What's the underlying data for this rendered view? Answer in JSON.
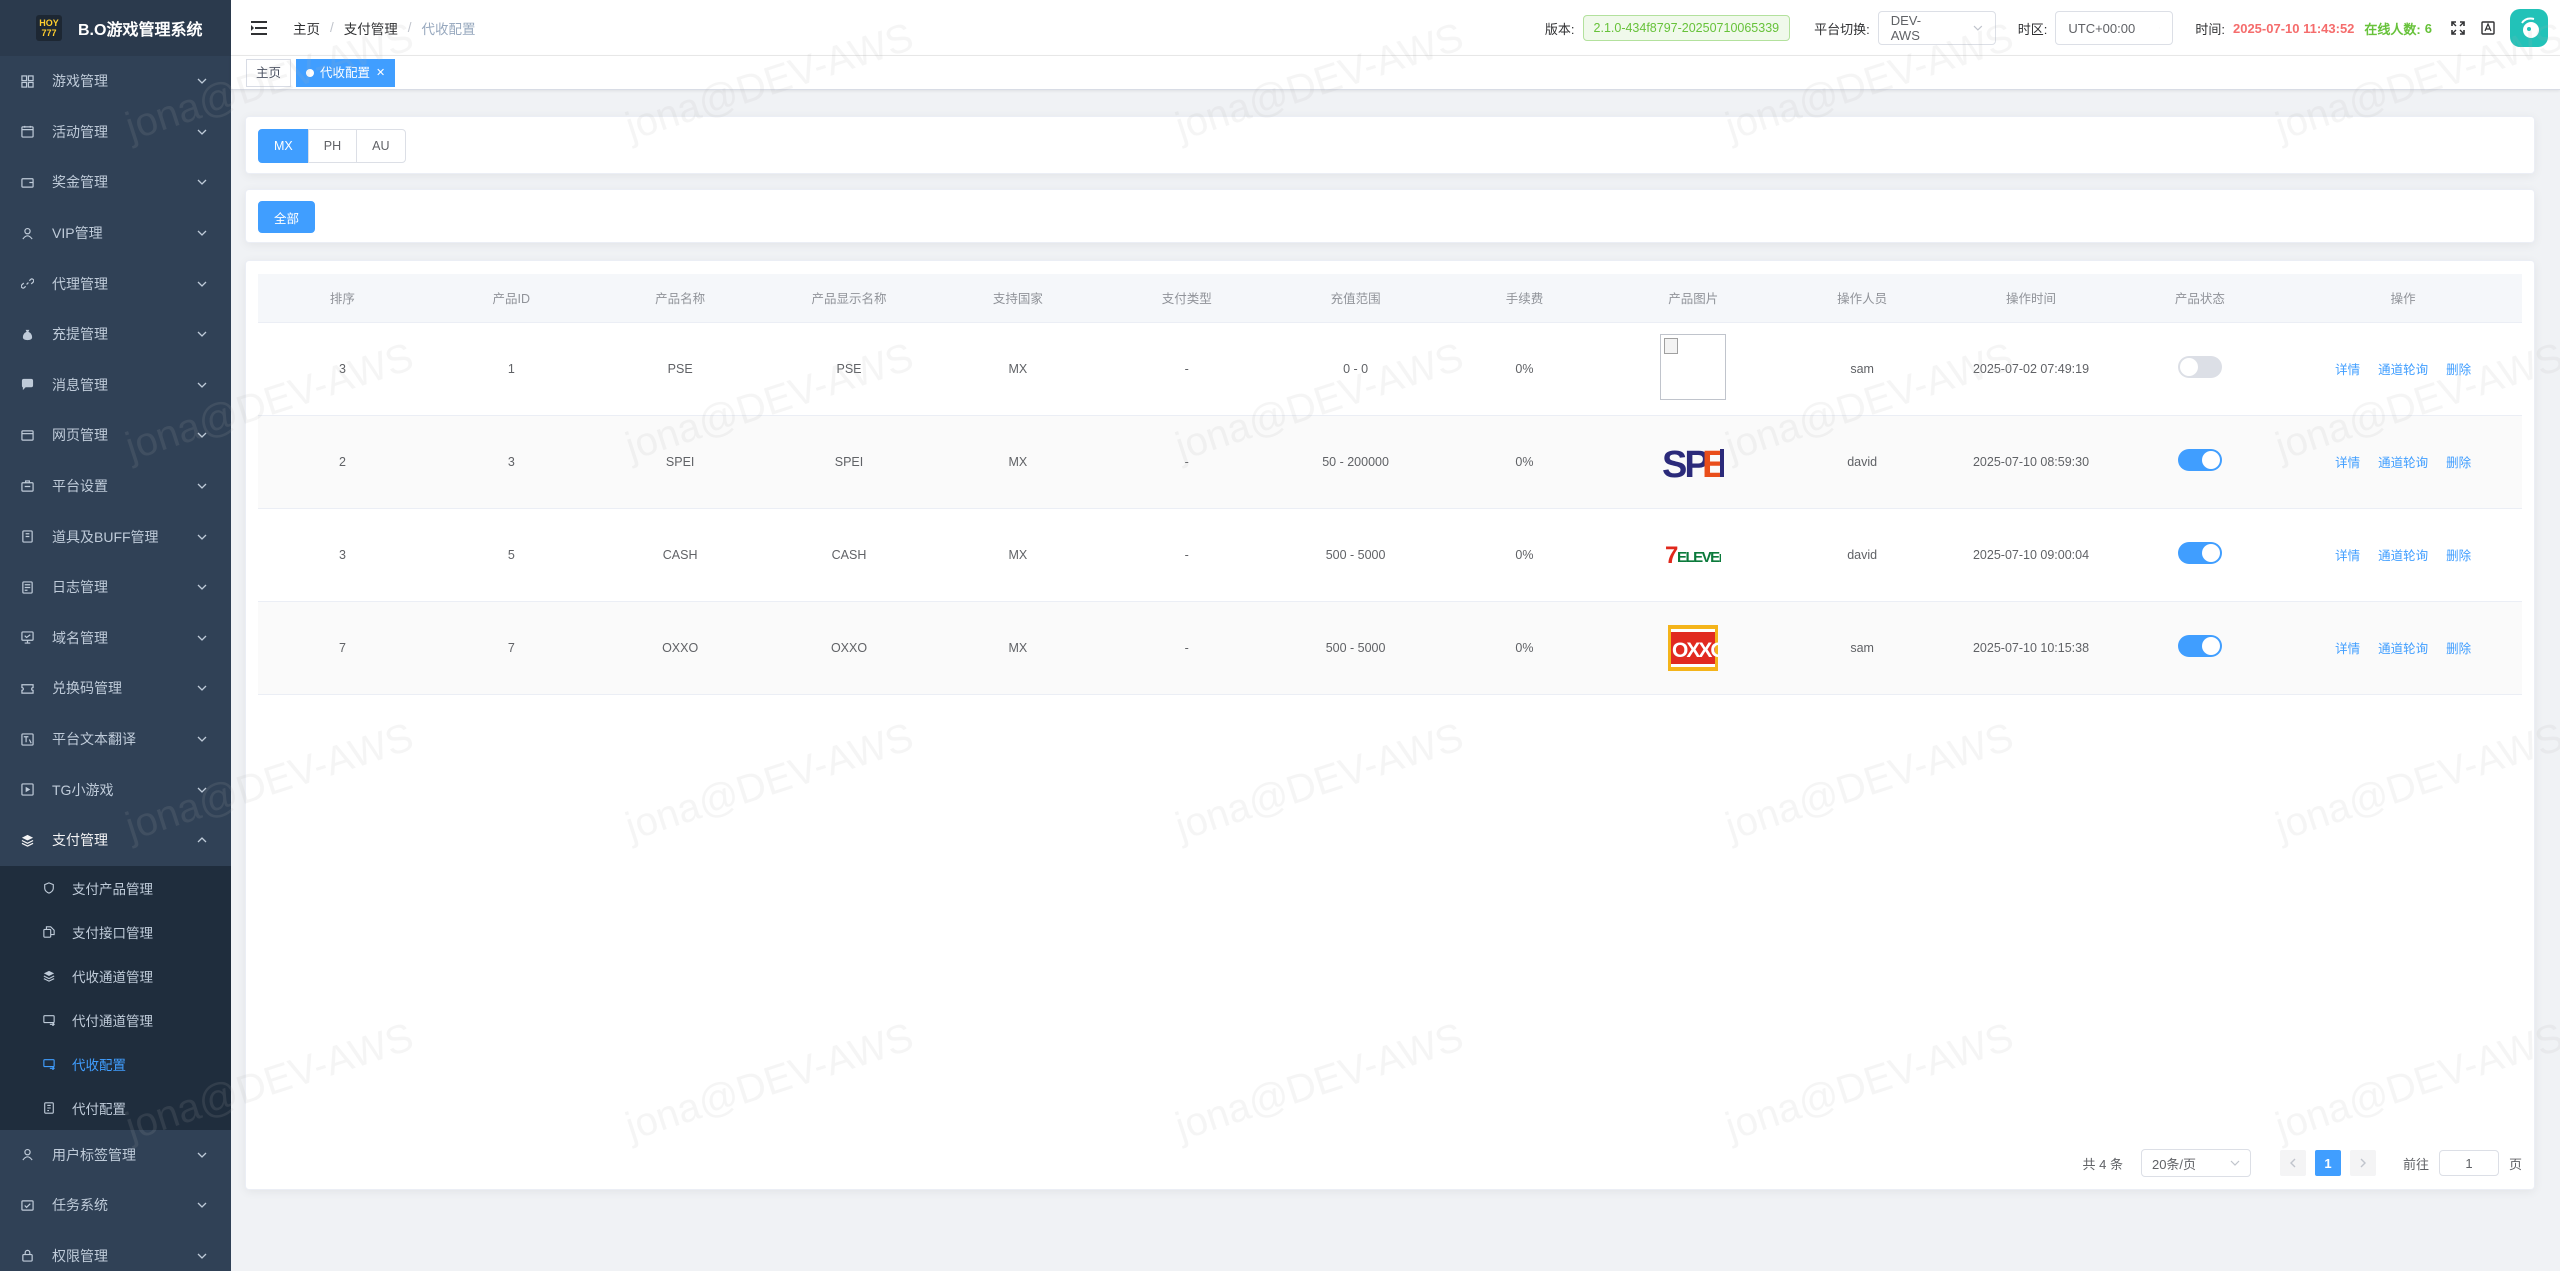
{
  "app": {
    "title": "B.O游戏管理系统",
    "logo_text": "HOY 777"
  },
  "sidebar": {
    "items": [
      {
        "label": "游戏管理",
        "icon": "grid-icon"
      },
      {
        "label": "活动管理",
        "icon": "calendar-icon"
      },
      {
        "label": "奖金管理",
        "icon": "wallet-icon"
      },
      {
        "label": "VIP管理",
        "icon": "user-icon"
      },
      {
        "label": "代理管理",
        "icon": "link-icon"
      },
      {
        "label": "充提管理",
        "icon": "money-bag-icon"
      },
      {
        "label": "消息管理",
        "icon": "message-icon"
      },
      {
        "label": "网页管理",
        "icon": "browser-icon"
      },
      {
        "label": "平台设置",
        "icon": "settings-icon"
      },
      {
        "label": "道具及BUFF管理",
        "icon": "box-icon"
      },
      {
        "label": "日志管理",
        "icon": "log-icon"
      },
      {
        "label": "域名管理",
        "icon": "monitor-icon"
      },
      {
        "label": "兑换码管理",
        "icon": "ticket-icon"
      },
      {
        "label": "平台文本翻译",
        "icon": "translate-icon"
      },
      {
        "label": "TG小游戏",
        "icon": "gamepad-icon"
      },
      {
        "label": "支付管理",
        "icon": "layers-icon"
      }
    ],
    "payment_sub": [
      {
        "label": "支付产品管理",
        "icon": "shield-icon"
      },
      {
        "label": "支付接口管理",
        "icon": "plug-icon"
      },
      {
        "label": "代收通道管理",
        "icon": "layers-icon"
      },
      {
        "label": "代付通道管理",
        "icon": "transfer-icon"
      },
      {
        "label": "代收配置",
        "icon": "transfer-icon"
      },
      {
        "label": "代付配置",
        "icon": "document-icon"
      }
    ],
    "items_after": [
      {
        "label": "用户标签管理",
        "icon": "user-tag-icon"
      },
      {
        "label": "任务系统",
        "icon": "task-icon"
      },
      {
        "label": "权限管理",
        "icon": "lock-icon"
      }
    ]
  },
  "header": {
    "breadcrumb": [
      "主页",
      "支付管理",
      "代收配置"
    ],
    "version_label": "版本:",
    "version_value": "2.1.0-434f8797-20250710065339",
    "platform_label": "平台切换:",
    "platform_value": "DEV-AWS",
    "timezone_label": "时区:",
    "timezone_value": "UTC+00:00",
    "time_label": "时间:",
    "time_value": "2025-07-10 11:43:52",
    "online_label": "在线人数:",
    "online_value": "6"
  },
  "tags": [
    {
      "label": "主页",
      "active": false
    },
    {
      "label": "代收配置",
      "active": true
    }
  ],
  "country_tabs": [
    "MX",
    "PH",
    "AU"
  ],
  "filter": {
    "all_label": "全部"
  },
  "table": {
    "columns": [
      "排序",
      "产品ID",
      "产品名称",
      "产品显示名称",
      "支持国家",
      "支付类型",
      "充值范围",
      "手续费",
      "产品图片",
      "操作人员",
      "操作时间",
      "产品状态",
      "操作"
    ],
    "rows": [
      {
        "sort": "3",
        "id": "1",
        "name": "PSE",
        "display": "PSE",
        "country": "MX",
        "type": "-",
        "range": "0 - 0",
        "fee": "0%",
        "image": "broken",
        "operator": "sam",
        "time": "2025-07-02 07:49:19",
        "enabled": false
      },
      {
        "sort": "2",
        "id": "3",
        "name": "SPEI",
        "display": "SPEI",
        "country": "MX",
        "type": "-",
        "range": "50 - 200000",
        "fee": "0%",
        "image": "SPEI",
        "operator": "david",
        "time": "2025-07-10 08:59:30",
        "enabled": true
      },
      {
        "sort": "3",
        "id": "5",
        "name": "CASH",
        "display": "CASH",
        "country": "MX",
        "type": "-",
        "range": "500 - 5000",
        "fee": "0%",
        "image": "7-ELEVEn",
        "operator": "david",
        "time": "2025-07-10 09:00:04",
        "enabled": true
      },
      {
        "sort": "7",
        "id": "7",
        "name": "OXXO",
        "display": "OXXO",
        "country": "MX",
        "type": "-",
        "range": "500 - 5000",
        "fee": "0%",
        "image": "OXXO",
        "operator": "sam",
        "time": "2025-07-10 10:15:38",
        "enabled": true
      }
    ],
    "actions": [
      "详情",
      "通道轮询",
      "删除"
    ]
  },
  "pagination": {
    "total": "共 4 条",
    "page_size": "20条/页",
    "current": "1",
    "goto_label": "前往",
    "goto_value": "1",
    "page_unit": "页"
  },
  "watermark": "jona@DEV-AWS",
  "colors": {
    "primary": "#409eff",
    "sidebar_bg": "#304156",
    "success": "#67c23a",
    "danger": "#f56c6c"
  }
}
